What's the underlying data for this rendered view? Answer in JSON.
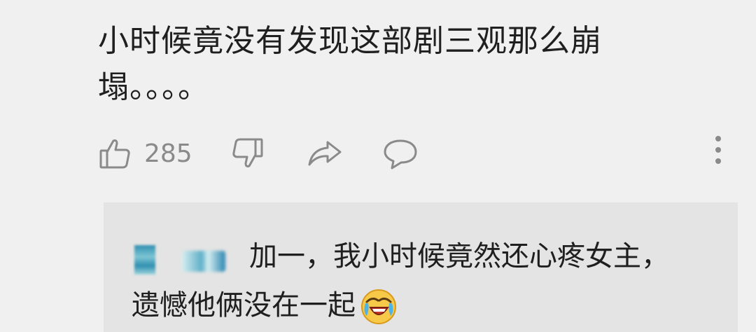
{
  "comment": {
    "text": "小时候竟没有发现这部剧三观那么崩塌。。。。"
  },
  "actions": {
    "like_count": "285",
    "icons": [
      "thumbs-up-icon",
      "thumbs-down-icon",
      "share-icon",
      "comment-icon",
      "more-icon"
    ]
  },
  "reply": {
    "username_blurred": true,
    "text": "加一，我小时候竟然还心疼女主，遗憾他俩没在一起",
    "emoji": "crying-laughing-emoji"
  },
  "colors": {
    "background": "#f0f0f0",
    "reply_background": "#e4e4e4",
    "text": "#1f1f1f",
    "icon": "#8a8a8a"
  }
}
